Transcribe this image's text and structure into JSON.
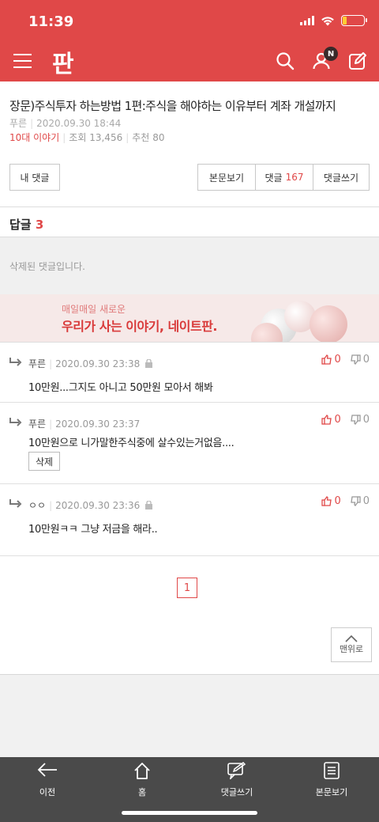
{
  "status": {
    "time": "11:39"
  },
  "nav": {
    "logo": "판",
    "badge": "N"
  },
  "article": {
    "title": "장문)주식투자 하는방법 1편:주식을 해야하는 이유부터 계좌 개설까지",
    "author": "푸른",
    "date": "2020.09.30 18:44",
    "category": "10대 이야기",
    "views_label": "조회",
    "views": "13,456",
    "recommend_label": "추천",
    "recommend": "80"
  },
  "buttons": {
    "my_comments": "내 댓글",
    "view_body": "본문보기",
    "comments_label": "댓글",
    "comments_count": "167",
    "write_comment": "댓글쓰기"
  },
  "replies": {
    "label": "답글",
    "count": "3",
    "deleted_text": "삭제된 댓글입니다."
  },
  "banner": {
    "sub": "매일매일 새로운",
    "main": "우리가 사는 이야기, 네이트판."
  },
  "comments": [
    {
      "author": "푸른",
      "date": "2020.09.30 23:38",
      "text": "10만원...그지도 아니고 50만원 모아서 해봐",
      "up": "0",
      "down": "0"
    },
    {
      "author": "푸른",
      "date": "2020.09.30 23:37",
      "text": "10만원으로 니가말한주식중에 살수있는거없음....",
      "up": "0",
      "down": "0",
      "delete": "삭제"
    },
    {
      "author": "ㅇㅇ",
      "date": "2020.09.30 23:36",
      "text": "10만원ㅋㅋ 그냥 저금을 해라..",
      "up": "0",
      "down": "0"
    }
  ],
  "pagination": {
    "current": "1"
  },
  "scroll_top": {
    "label": "맨위로"
  },
  "tabbar": {
    "prev": "이전",
    "home": "홈",
    "write": "댓글쓰기",
    "view": "본문보기"
  },
  "colors": {
    "brand": "#e04848",
    "tabbar": "#4a4a4a"
  }
}
